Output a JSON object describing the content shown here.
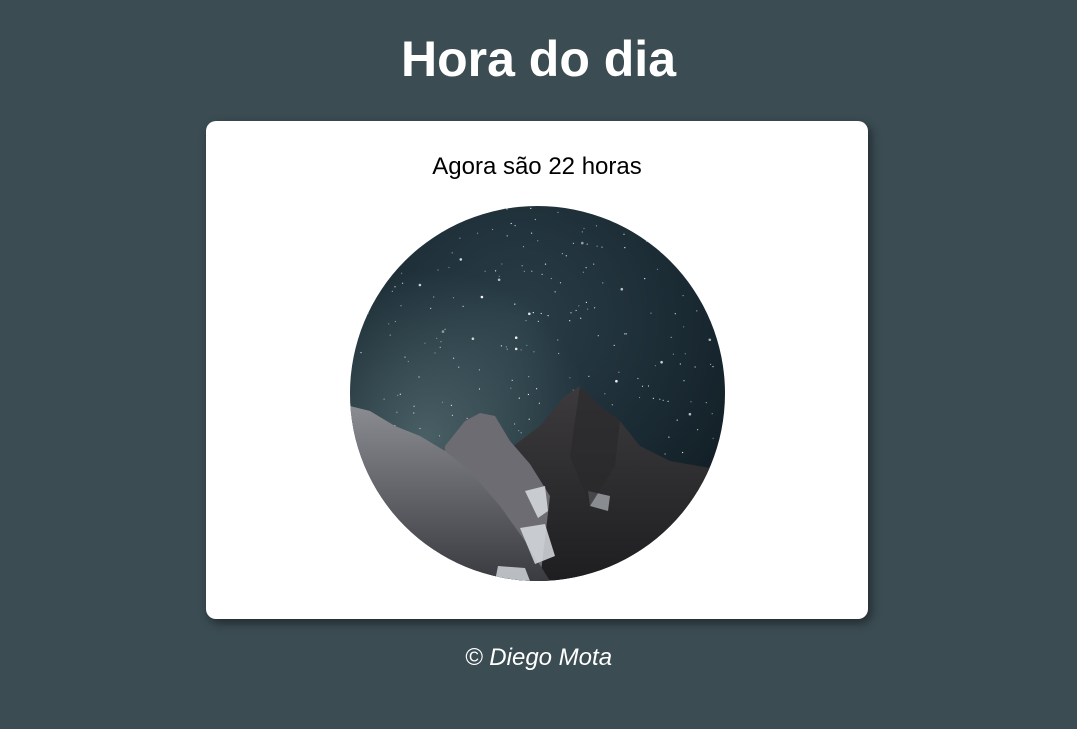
{
  "page": {
    "title": "Hora do dia"
  },
  "card": {
    "message": "Agora são 22 horas",
    "image_scene": "night-sky-mountains"
  },
  "footer": {
    "text": "© Diego Mota"
  },
  "colors": {
    "background": "#3b4c53",
    "card": "#ffffff",
    "title": "#ffffff",
    "message": "#000000"
  }
}
